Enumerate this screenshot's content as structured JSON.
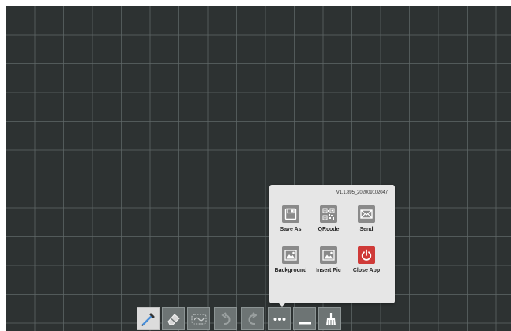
{
  "menu": {
    "version": "V1.1.895_202009102047",
    "items": [
      {
        "label": "Save As",
        "icon": "save-icon"
      },
      {
        "label": "QRcode",
        "icon": "qrcode-icon"
      },
      {
        "label": "Send",
        "icon": "mail-icon"
      },
      {
        "label": "Background",
        "icon": "background-image-icon"
      },
      {
        "label": "Insert Pic",
        "icon": "insert-picture-icon"
      },
      {
        "label": "Close App",
        "icon": "power-icon"
      }
    ]
  },
  "toolbar": {
    "tools": [
      "pen",
      "eraser",
      "lasso",
      "undo",
      "redo",
      "more",
      "minimize",
      "clear"
    ],
    "active": "pen"
  },
  "colors": {
    "canvas": "#2d3232",
    "grid": "#5f6767",
    "menu": "#e6e6e6",
    "close_red": "#cf3a38",
    "tool_gray": "#6d7474"
  }
}
